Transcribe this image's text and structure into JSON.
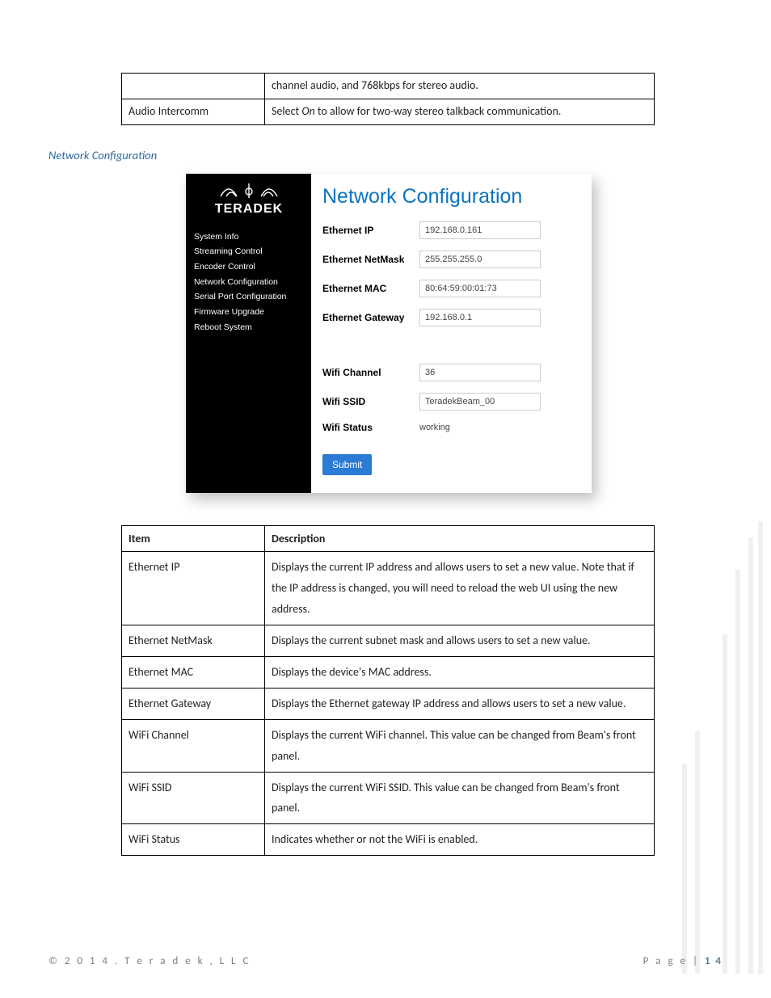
{
  "top_table": {
    "row0_desc": "channel audio, and 768kbps for stereo audio.",
    "row1_item": "Audio Intercomm",
    "row1_desc_pre": "Select ",
    "row1_desc_em": "On",
    "row1_desc_post": " to allow for two-way stereo talkback communication."
  },
  "section_heading": "Network Configuration",
  "screenshot": {
    "brand": "TERADEK",
    "sidebar": {
      "items": [
        "System Info",
        "Streaming Control",
        "Encoder Control",
        "Network Configuration",
        "Serial Port Configuration",
        "Firmware Upgrade",
        "Reboot System"
      ]
    },
    "panel": {
      "title": "Network Configuration",
      "ethernet_ip_label": "Ethernet IP",
      "ethernet_ip_value": "192.168.0.161",
      "ethernet_netmask_label": "Ethernet NetMask",
      "ethernet_netmask_value": "255.255.255.0",
      "ethernet_mac_label": "Ethernet MAC",
      "ethernet_mac_value": "80:64:59:00:01:73",
      "ethernet_gateway_label": "Ethernet Gateway",
      "ethernet_gateway_value": "192.168.0.1",
      "wifi_channel_label": "Wifi Channel",
      "wifi_channel_value": "36",
      "wifi_ssid_label": "Wifi SSID",
      "wifi_ssid_value": "TeradekBeam_00",
      "wifi_status_label": "Wifi Status",
      "wifi_status_value": "working",
      "submit_label": "Submit"
    }
  },
  "desc_table": {
    "head_item": "Item",
    "head_desc": "Description",
    "rows": [
      {
        "item": "Ethernet IP",
        "desc": "Displays the current IP address and allows users to set a new value. Note that if the IP address is changed, you will need to reload the web UI using the new address."
      },
      {
        "item": "Ethernet NetMask",
        "desc": "Displays the current subnet mask and allows users to set a new value."
      },
      {
        "item": "Ethernet MAC",
        "desc": "Displays the device's MAC address."
      },
      {
        "item": "Ethernet Gateway",
        "desc": "Displays the Ethernet gateway IP address and allows users to set a new value."
      },
      {
        "item": "WiFi Channel",
        "desc": "Displays the current WiFi channel. This value can be changed from Beam's front panel."
      },
      {
        "item": "WiFi SSID",
        "desc": "Displays the current WiFi SSID. This value can be changed from Beam's front panel."
      },
      {
        "item": "WiFi Status",
        "desc": "Indicates whether or not the WiFi is enabled."
      }
    ]
  },
  "footer": {
    "copyright": "© 2 0 1 4 .   T e r a d e k ,  L L C",
    "page_label": "P a g e   | ",
    "page_number": "1 4"
  }
}
